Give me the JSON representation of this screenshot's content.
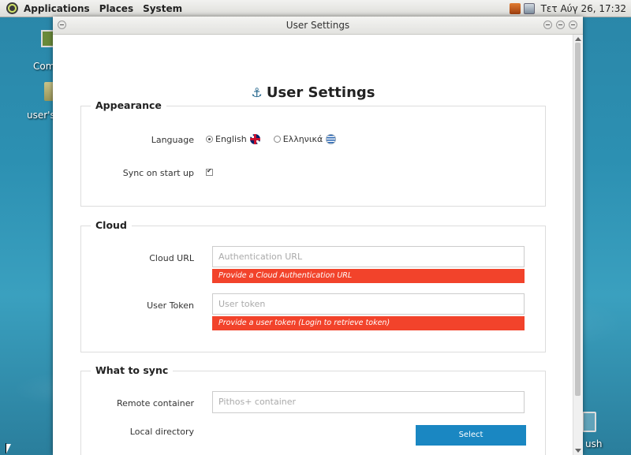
{
  "panel": {
    "menus": [
      "Applications",
      "Places",
      "System"
    ],
    "clock": "Τετ Αύγ 26, 17:32"
  },
  "desktop": {
    "icons": [
      {
        "label": "Com"
      },
      {
        "label": "user's"
      },
      {
        "label": "ush"
      }
    ]
  },
  "window": {
    "title": "User Settings",
    "heading": "User Settings"
  },
  "appearance": {
    "legend": "Appearance",
    "language_label": "Language",
    "languages": [
      {
        "label": "English",
        "selected": true
      },
      {
        "label": "Ελληνικά",
        "selected": false
      }
    ],
    "sync_label": "Sync on start up",
    "sync_checked": true
  },
  "cloud": {
    "legend": "Cloud",
    "url_label": "Cloud URL",
    "url_placeholder": "Authentication URL",
    "url_error": "Provide a Cloud Authentication URL",
    "token_label": "User Token",
    "token_placeholder": "User token",
    "token_error": "Provide a user token (Login to retrieve token)"
  },
  "sync": {
    "legend": "What to sync",
    "container_label": "Remote container",
    "container_placeholder": "Pithos+ container",
    "directory_label": "Local directory",
    "select_label": "Select"
  },
  "colors": {
    "error": "#f2432b",
    "primary_button": "#1a87c2"
  }
}
